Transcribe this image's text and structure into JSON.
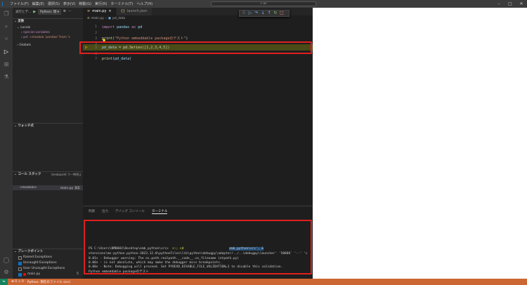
{
  "titlebar": {
    "menu": [
      "ファイル(F)",
      "編集(E)",
      "選択(S)",
      "表示(V)",
      "移動(G)",
      "実行(R)",
      "ターミナル(T)",
      "ヘルプ(H)"
    ],
    "search": "uc"
  },
  "sidebar": {
    "run_label": "実行とデ...",
    "config": "Python: 現 ▾",
    "variables_head": "変数",
    "locals": "Locals",
    "special_variables": "special variables",
    "pd_key": "pd:",
    "pd_value": "<module 'pandas' from 'c",
    "globals": "Globals",
    "watch_head": "ウォッチ式",
    "callstack_head": "コール スタック",
    "callstack_paused": "breakpoint で一時停止",
    "frame_name": "<module>",
    "frame_file": "main.py",
    "frame_line": "5:1",
    "breakpoints_head": "ブレークポイント",
    "bp_items": [
      "Raised Exceptions",
      "Uncaught Exceptions",
      "User Uncaught Exceptions",
      "main.py"
    ],
    "bp_count": "5"
  },
  "tabs": {
    "main": "main.py",
    "launch": "launch.json"
  },
  "breadcrumb": {
    "file": "main.py",
    "symbol": "pd_data"
  },
  "editor": {
    "line_numbers": [
      "1",
      "2",
      "3",
      "4",
      "5",
      "6",
      "7"
    ],
    "code": {
      "l1_kw": "import",
      "l1_rest": " pandas ",
      "l1_as": "as",
      "l1_alias": " pd",
      "l3_fn": "print",
      "l3_str": "\"Python embeddable packageのテスト\"",
      "l5_var": "pd_data",
      "l5_eq": " = pd.",
      "l5_fn": "Series",
      "l5_args": "([1,2,3,4,5])",
      "l7_fn": "print",
      "l7_arg": "pd_data"
    }
  },
  "panel": {
    "tabs": [
      "問題",
      "出力",
      "デバッグ コンソール",
      "ターミナル"
    ],
    "terminal": {
      "prompt": "PS C:\\Users\\BMB003\\Desktop\\emb_python\\src> ",
      "cmd1": " c:; cd ",
      "path_hl": "emb_python\\src'; &",
      "line2": "xtensions\\ms-python.python-2023.12.0\\pythonFiles\\lib\\python\\debugpy\\adapter/../..\\debugpy\\launcher' '50806' '--' 'c",
      "line3": "0.01s - Debugger warning: The os.path.realpath.__code__.co_filename (ntpath.py)",
      "line4": "0.00s - is not absolute, which may make the debugger miss breakpoints.",
      "line5": "0.00s - Note: Debugging will proceed. Set PYDEVD_DISABLE_FILE_VALIDATION=1 to disable this validation.",
      "line6": "Python embeddable packageのテスト"
    }
  },
  "status": {
    "errors": "⊗ 0  ⚠ 0",
    "debug": "Python: 現在のファイル (src)"
  },
  "colors": {
    "highlight_box": "#e0201f",
    "status_bar": "#cc6633",
    "current_line": "#4b4b18"
  }
}
